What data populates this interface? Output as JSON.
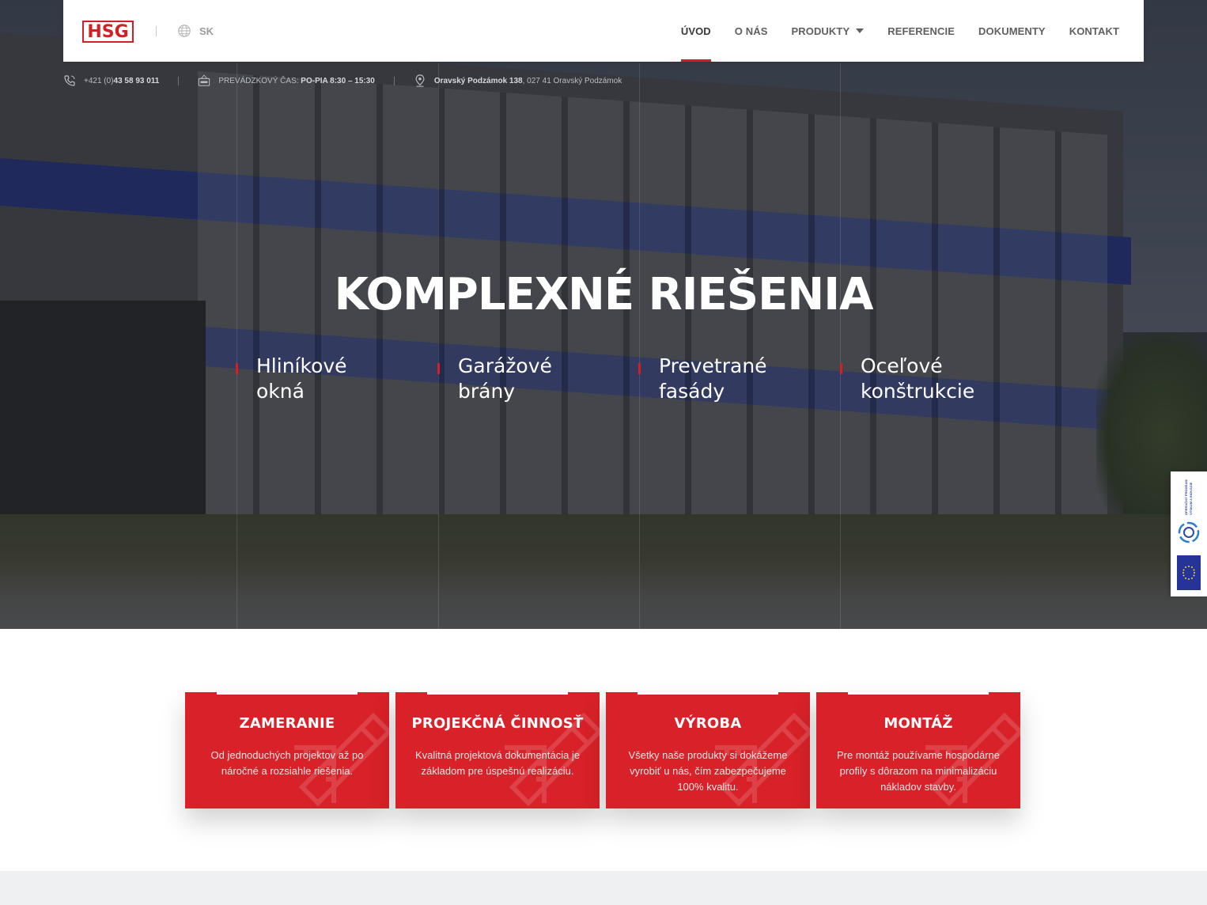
{
  "header": {
    "logo_text": "HSG",
    "language": "SK",
    "nav": [
      {
        "label": "ÚVOD",
        "active": true
      },
      {
        "label": "O NÁS",
        "active": false
      },
      {
        "label": "PRODUKTY",
        "active": false,
        "has_dropdown": true
      },
      {
        "label": "REFERENCIE",
        "active": false
      },
      {
        "label": "DOKUMENTY",
        "active": false
      },
      {
        "label": "KONTAKT",
        "active": false
      }
    ]
  },
  "infobar": {
    "phone_prefix": "+421 (0)",
    "phone_number": "43 58 93 011",
    "hours_label": "PREVÁDZKOVÝ ČAS:",
    "hours_value": "PO-PIA 8:30 – 15:30",
    "address_bold": "Oravský Podzámok 138",
    "address_rest": ", 027 41 Oravský Podzámok"
  },
  "hero": {
    "title": "KOMPLEXNÉ RIEŠENIA",
    "pillars": [
      {
        "line1": "Hliníkové",
        "line2": "okná"
      },
      {
        "line1": "Garážové",
        "line2": "brány"
      },
      {
        "line1": "Prevetrané",
        "line2": "fasády"
      },
      {
        "line1": "Oceľové",
        "line2": "konštrukcie"
      }
    ]
  },
  "eu_badge": {
    "text": "OPERAČNÝ PROGRAM VÝSKUM A INOVÁCIE"
  },
  "services": [
    {
      "title": "ZAMERANIE",
      "text": "Od jednoduchých projektov až po náročné a rozsiahle riešenia."
    },
    {
      "title": "PROJEKČNÁ ČINNOSŤ",
      "text": "Kvalitná projektová dokumentácia je základom pre úspešnú realizáciu."
    },
    {
      "title": "VÝROBA",
      "text": "Všetky naše produkty si dokážeme vyrobiť u nás, čím zabezpečujeme 100% kvalitu."
    },
    {
      "title": "MONTÁŽ",
      "text": "Pre montáž používame hospodárne profily s dôrazom na minimalizáciu nákladov stavby."
    }
  ],
  "colors": {
    "accent": "#d32027",
    "card_red": "#d82128",
    "nav_text": "#606060",
    "footer_strip": "#eef0f2"
  },
  "icons": [
    "globe-icon",
    "phone-icon",
    "open-sign-icon",
    "location-pin-icon",
    "chevron-down-icon",
    "pencil-ruler-icon"
  ]
}
